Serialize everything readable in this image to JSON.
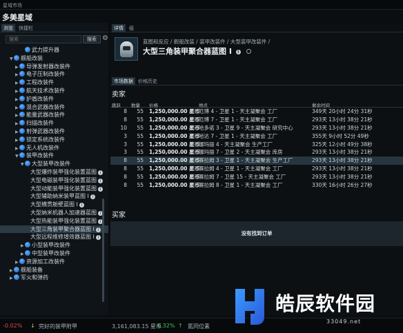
{
  "window": {
    "top_label": "星域市场",
    "title": "多美星域"
  },
  "left_panel": {
    "tabs": [
      "浏览",
      "快捷栏"
    ],
    "search_placeholder": "搜索",
    "search_button": "搜索",
    "tree": [
      {
        "label": "武力提升器",
        "depth": 3,
        "arrow": "",
        "icon": true
      },
      {
        "label": "舰船改装",
        "depth": 1,
        "arrow": "▼",
        "icon": true
      },
      {
        "label": "导弹发射器改装件",
        "depth": 2,
        "arrow": "▶",
        "icon": true
      },
      {
        "label": "电子压制改装件",
        "depth": 2,
        "arrow": "▶",
        "icon": true
      },
      {
        "label": "工程改装件",
        "depth": 2,
        "arrow": "▶",
        "icon": true
      },
      {
        "label": "航天技术改装件",
        "depth": 2,
        "arrow": "▶",
        "icon": true
      },
      {
        "label": "护盾改装件",
        "depth": 2,
        "arrow": "▶",
        "icon": true
      },
      {
        "label": "混合武器改装件",
        "depth": 2,
        "arrow": "▶",
        "icon": true
      },
      {
        "label": "能量武器改装件",
        "depth": 2,
        "arrow": "▶",
        "icon": true
      },
      {
        "label": "扫描改装件",
        "depth": 2,
        "arrow": "▶",
        "icon": true
      },
      {
        "label": "射弹武器改装件",
        "depth": 2,
        "arrow": "▶",
        "icon": true
      },
      {
        "label": "锁定系统改装件",
        "depth": 2,
        "arrow": "▶",
        "icon": true
      },
      {
        "label": "无人机改装件",
        "depth": 2,
        "arrow": "▶",
        "icon": true
      },
      {
        "label": "装甲改装件",
        "depth": 2,
        "arrow": "▼",
        "icon": true
      },
      {
        "label": "大型装甲改装件",
        "depth": 3,
        "arrow": "▼",
        "icon": true
      },
      {
        "label": "大型爆炸装甲强化装置蓝图",
        "depth": 4,
        "arrow": "",
        "icon": false,
        "info": true
      },
      {
        "label": "大型电磁装甲强化装置蓝图",
        "depth": 4,
        "arrow": "",
        "icon": false,
        "info": true
      },
      {
        "label": "大型动能装甲强化装置蓝图",
        "depth": 4,
        "arrow": "",
        "icon": false,
        "info": true
      },
      {
        "label": "大型辅助纳米装甲蓝图 I",
        "depth": 4,
        "arrow": "",
        "icon": false,
        "info": true
      },
      {
        "label": "大型横贯舱壁蓝图 I",
        "depth": 4,
        "arrow": "",
        "icon": false,
        "info": true
      },
      {
        "label": "大型纳米机器人加速器蓝图",
        "depth": 4,
        "arrow": "",
        "icon": false,
        "info": true
      },
      {
        "label": "大型热能装甲强化装置蓝图",
        "depth": 4,
        "arrow": "",
        "icon": false,
        "info": true
      },
      {
        "label": "大型三角装甲聚合器蓝图 I",
        "depth": 4,
        "arrow": "",
        "icon": false,
        "info": true,
        "selected": true
      },
      {
        "label": "大型远程维修增效器蓝图 I",
        "depth": 4,
        "arrow": "",
        "icon": false,
        "info": true
      },
      {
        "label": "小型装甲改装件",
        "depth": 3,
        "arrow": "▶",
        "icon": true
      },
      {
        "label": "中型装甲改装件",
        "depth": 3,
        "arrow": "▶",
        "icon": true
      },
      {
        "label": "资源加工改装件",
        "depth": 2,
        "arrow": "▶",
        "icon": true
      },
      {
        "label": "舰船装备",
        "depth": 1,
        "arrow": "▶",
        "icon": true
      },
      {
        "label": "军火和弹药",
        "depth": 1,
        "arrow": "▶",
        "icon": true
      }
    ]
  },
  "right_panel": {
    "tabs": [
      "详情",
      "组"
    ],
    "breadcrumb": "蓝图和反应 / 舰船改装 / 装甲改装件 / 大型装甲改装件 /",
    "item_name": "大型三角装甲聚合器蓝图 I",
    "sub_tabs": [
      "市场数据",
      "价格历史"
    ],
    "sellers": {
      "title": "卖家",
      "headers": [
        "跳跃",
        "数量",
        "价格",
        "地点",
        "剩余时间"
      ],
      "rows": [
        {
          "jumps": "8",
          "qty": "55",
          "price": "1,250,000.00 星币",
          "location": "厄博 4 - 卫星 1 - 天主凝聚会 工厂",
          "expires": "349天 20小时 24分 31秒"
        },
        {
          "jumps": "8",
          "qty": "55",
          "price": "1,250,000.00 星币",
          "location": "厄博 7 - 卫星 1 - 天主凝聚会 工厂",
          "expires": "293天 13小时 38分 21秒"
        },
        {
          "jumps": "10",
          "qty": "55",
          "price": "1,250,000.00 星币",
          "location": "哈多诺 3 - 卫星 9 - 天主凝聚会 研究中心",
          "expires": "293天 13小时 38分 21秒"
        },
        {
          "jumps": "3",
          "qty": "55",
          "price": "1,250,000.00 星币",
          "location": "哈达 7 - 卫星 1 - 天主凝聚会 工厂",
          "expires": "355天 9小时 52分 49秒"
        },
        {
          "jumps": "3",
          "qty": "55",
          "price": "1,250,000.00 星币",
          "location": "娜玛丽 4 - 天主凝聚会 生产工厂",
          "expires": "325天 12小时 49分 38秒"
        },
        {
          "jumps": "3",
          "qty": "55",
          "price": "1,250,000.00 星币",
          "location": "娜玛丽 7 - 卫星 2 - 天主凝聚会 库房",
          "expires": "293天 13小时 38分 21秒"
        },
        {
          "jumps": "8",
          "qty": "55",
          "price": "1,250,000.00 星币",
          "location": "赛拉姆 3 - 卫星 1 - 天主凝聚会 生产工厂",
          "expires": "293天 13小时 38分 21秒",
          "highlight": true
        },
        {
          "jumps": "8",
          "qty": "55",
          "price": "1,250,000.00 星币",
          "location": "赛拉姆 4 - 卫星 1 - 天主凝聚会 工厂",
          "expires": "293天 13小时 38分 21秒"
        },
        {
          "jumps": "8",
          "qty": "55",
          "price": "1,250,000.00 星币",
          "location": "赛拉姆 7 - 卫星 15 - 天主凝聚会 工厂",
          "expires": "293天 13小时 38分 21秒"
        },
        {
          "jumps": "8",
          "qty": "55",
          "price": "1,250,000.00 星币",
          "location": "赛拉姆 8 - 卫星 1 - 天主凝聚会 工厂",
          "expires": "330天 16小时 26分 27秒"
        }
      ]
    },
    "buyers": {
      "title": "买家",
      "empty_message": "没有找到订单"
    }
  },
  "bottom_bar": {
    "left_change": "-0.02%",
    "ticker_item": "完好的装甲附甲",
    "ticker_price": "3,161,083.15 星币",
    "ticker_change": "0.32%",
    "right_text": "氮同位素"
  },
  "watermark": {
    "text": "皓辰软件园",
    "url": "33049.net"
  },
  "colors": {
    "accent_icon": "#3b8ff0",
    "positive": "#3fc65a",
    "negative": "#e04848",
    "highlight_row": "#26353e"
  }
}
